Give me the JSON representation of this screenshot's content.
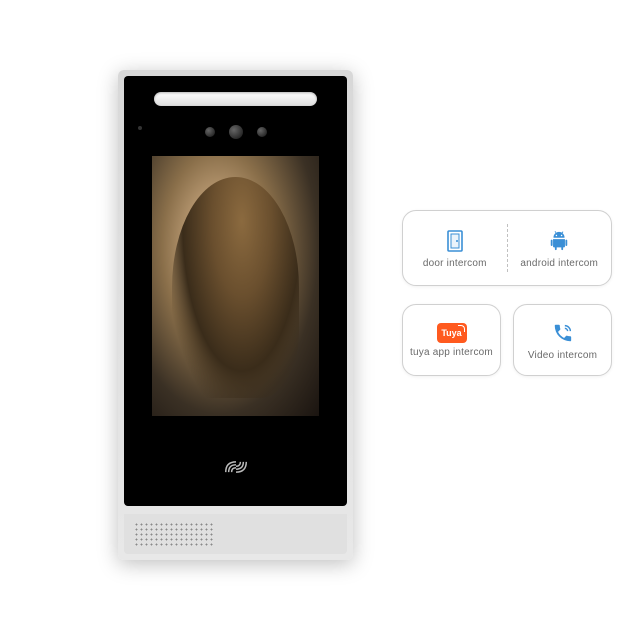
{
  "features": {
    "door_label": "door intercom",
    "android_label": "android intercom",
    "tuya_label": "tuya app intercom",
    "tuya_logo_text": "Tuya",
    "video_label": "Video intercom"
  },
  "colors": {
    "icon_blue": "#3a8fd6",
    "tuya_orange": "#ff5a1f"
  }
}
